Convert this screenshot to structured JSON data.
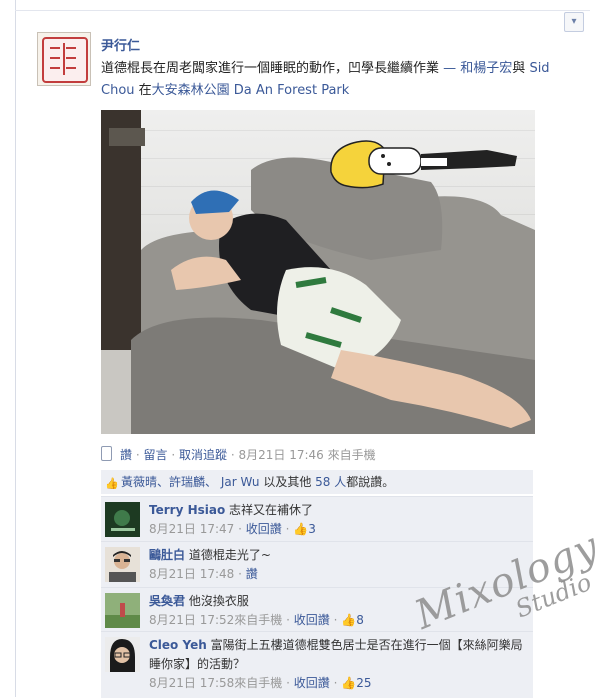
{
  "post": {
    "author": "尹行仁",
    "text": "道德棍長在周老闆家進行一個睡眠的動作，凹學長繼續作業",
    "tag_sep": " — 和",
    "tag1": "楊子宏",
    "tag_and": "與 ",
    "tag2": "Sid Chou",
    "loc_prefix": " 在",
    "location": "大安森林公園 Da An Forest Park"
  },
  "meta": {
    "like": "讚",
    "comment": "留言",
    "unfollow": "取消追蹤",
    "time": "8月21日 17:46 來自手機",
    "sep": "·"
  },
  "likes": {
    "names": "黃薇晴、許瑞麟、 Jar Wu",
    "mid": " 以及其他 ",
    "others": "58 人",
    "tail": "都說讚。"
  },
  "comments": [
    {
      "name": "Terry Hsiao",
      "text": "志祥又在補休了",
      "time": "8月21日 17:47",
      "action": "收回讚",
      "likes": "3"
    },
    {
      "name": "鷗肚白",
      "text": "道德棍走光了~",
      "time": "8月21日 17:48",
      "action": "讚",
      "likes": ""
    },
    {
      "name": "吳奐君",
      "text": "他沒換衣服",
      "time": "8月21日 17:52來自手機",
      "action": "收回讚",
      "likes": "8"
    },
    {
      "name": "Cleo Yeh",
      "text": "富陽街上五樓道德棍雙色居士是否在進行一個【來絲阿樂局睡你家】的活動？",
      "time": "8月21日 17:58來自手機",
      "action": "收回讚",
      "likes": "25"
    }
  ],
  "watermark": {
    "line1": "Mixology",
    "line2": "Studio"
  },
  "icons": [
    "chevron-down-icon",
    "mobile-icon",
    "thumbs-up-icon"
  ],
  "colors": {
    "link": "#3b5998",
    "comment_bg": "#edeff4",
    "meta": "#999999"
  }
}
